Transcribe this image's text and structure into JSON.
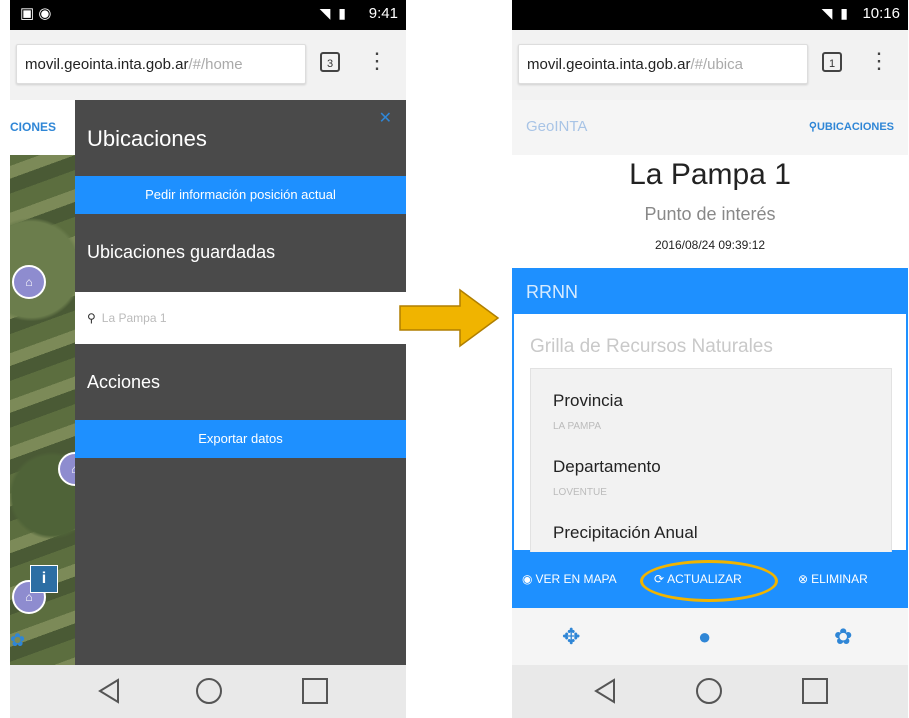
{
  "phone_left": {
    "status_time": "9:41",
    "url_host": "movil.geointa.inta.gob.ar",
    "url_path": "/#/home",
    "tab_count": "3",
    "map_label": "CIONES",
    "drawer": {
      "title": "Ubicaciones",
      "request_button": "Pedir información posición actual",
      "saved_heading": "Ubicaciones guardadas",
      "saved_item": "La Pampa 1",
      "actions_heading": "Acciones",
      "export_button": "Exportar datos"
    }
  },
  "phone_right": {
    "status_time": "10:16",
    "url_host": "movil.geointa.inta.gob.ar",
    "url_path": "/#/ubica",
    "tab_count": "1",
    "brand": "GeoINTA",
    "locations_link": "UBICACIONES",
    "place_title": "La Pampa 1",
    "place_subtitle": "Punto de interés",
    "place_date": "2016/08/24 09:39:12",
    "panel": {
      "header": "RRNN",
      "subtitle": "Grilla de Recursos Naturales",
      "fields": [
        {
          "label": "Provincia",
          "value": "LA PAMPA"
        },
        {
          "label": "Departamento",
          "value": "LOVENTUE"
        },
        {
          "label": "Precipitación Anual",
          "value": ""
        }
      ]
    },
    "actions": {
      "view_map": "VER EN MAPA",
      "update": "ACTUALIZAR",
      "delete": "ELIMINAR"
    }
  },
  "colors": {
    "accent": "#1e90ff",
    "drawer_bg": "#4a4a4a",
    "arrow": "#f0b400"
  }
}
